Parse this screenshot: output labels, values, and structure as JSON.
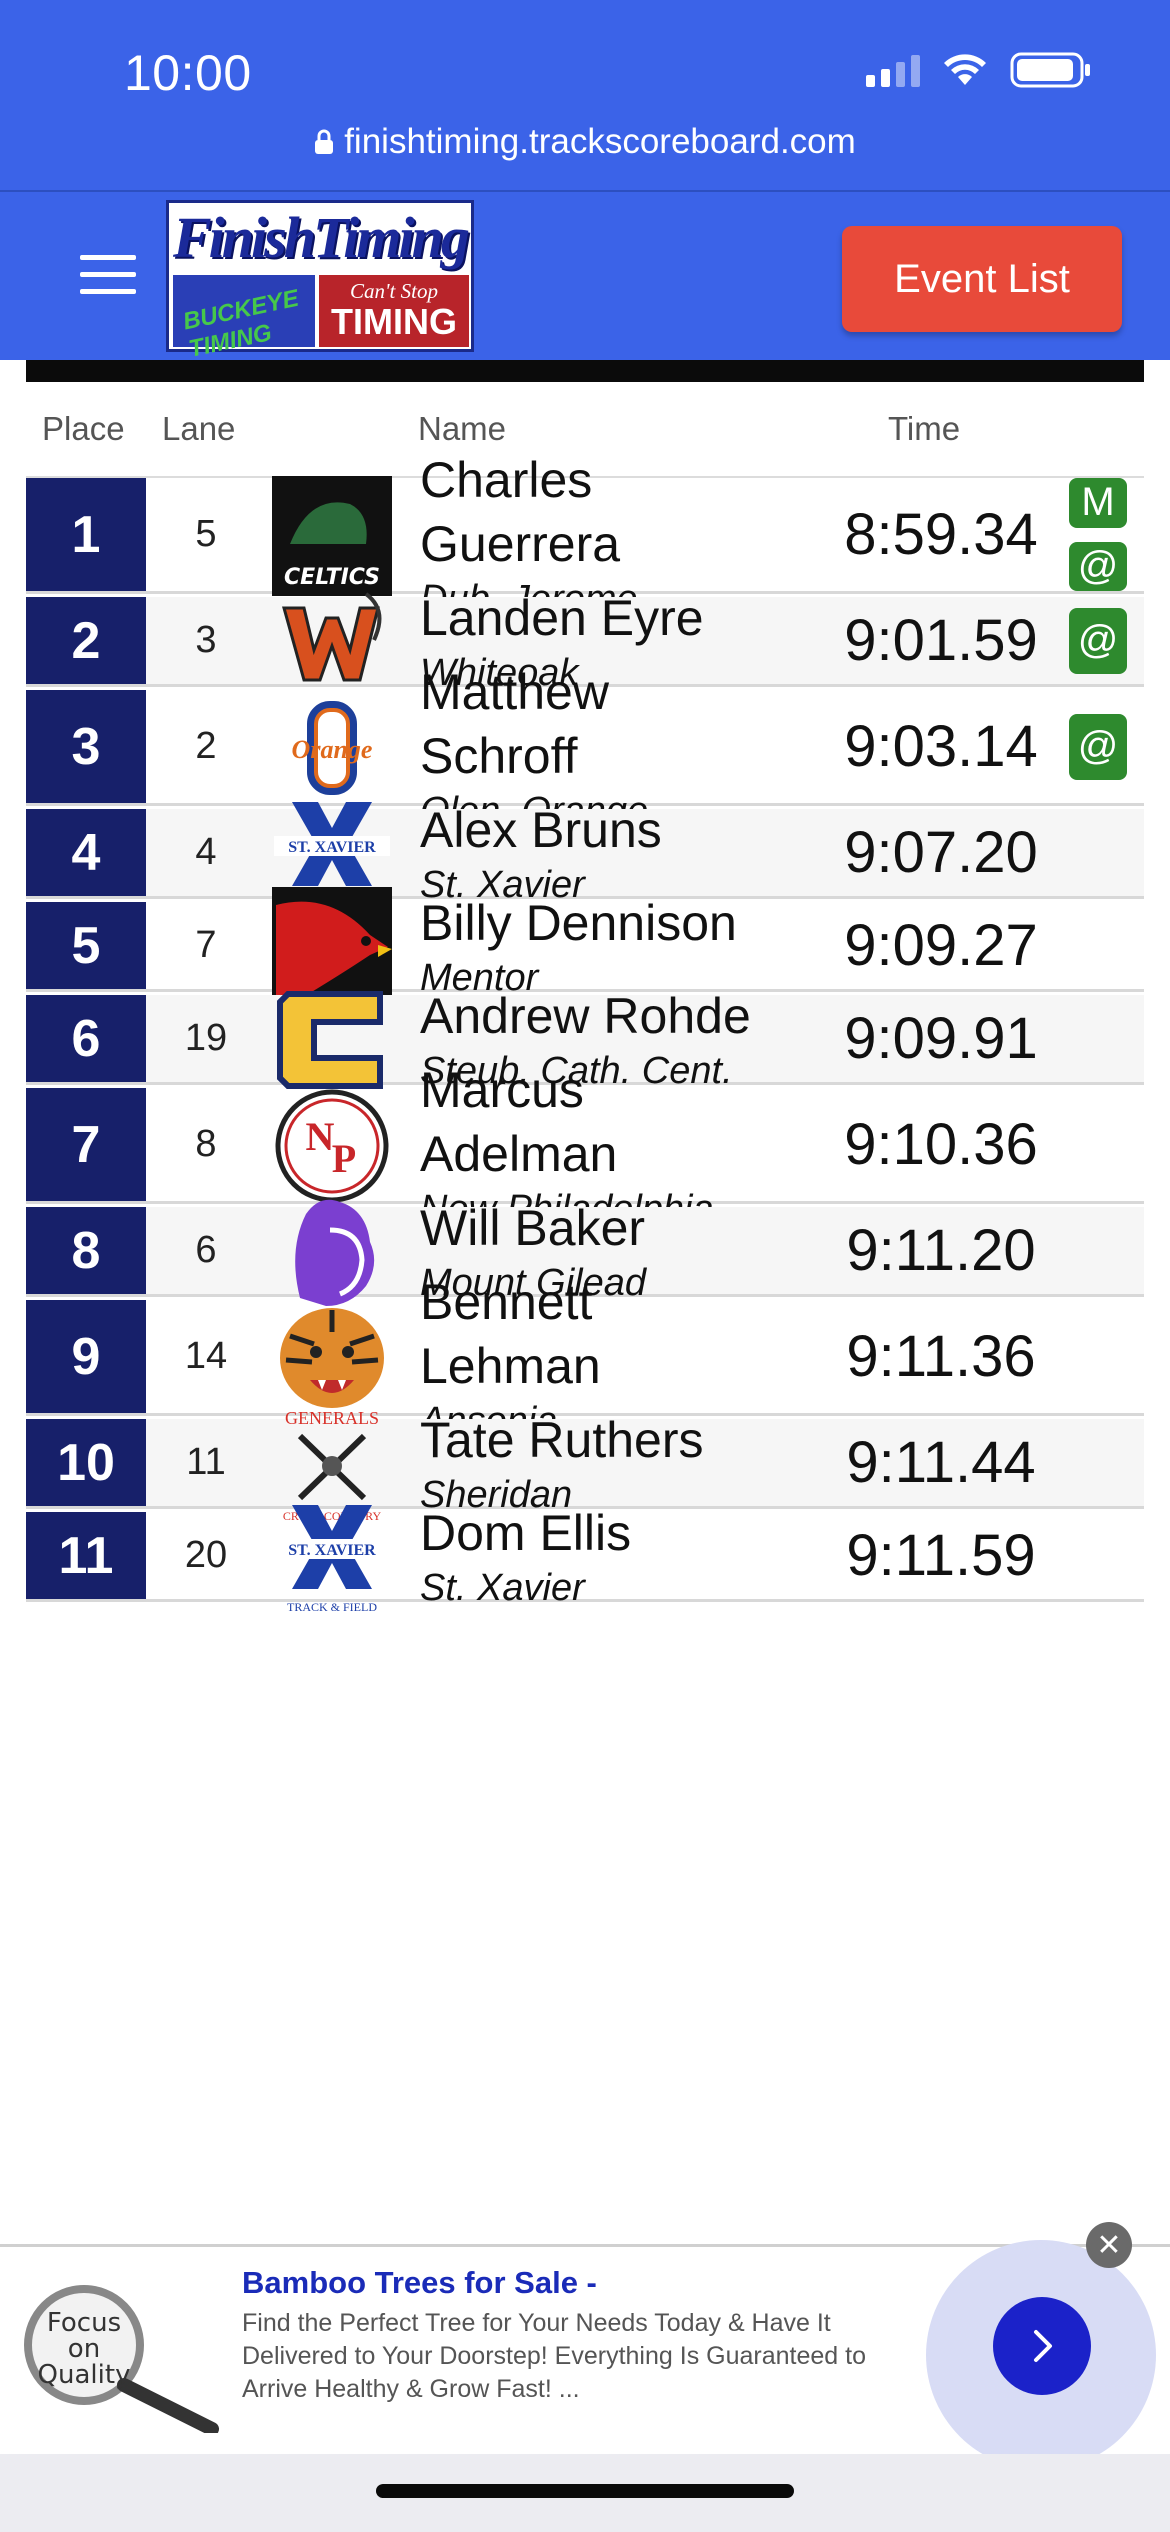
{
  "status": {
    "time": "10:00",
    "url": "finishtiming.trackscoreboard.com"
  },
  "header": {
    "logo": {
      "title": "FinishTiming",
      "left_text": "BUCKEYE TIMING",
      "right_sub": "Can't Stop",
      "right_main": "TIMING"
    },
    "event_list_label": "Event List"
  },
  "table": {
    "columns": {
      "place": "Place",
      "lane": "Lane",
      "name": "Name",
      "time": "Time"
    },
    "rows": [
      {
        "place": "1",
        "lane": "5",
        "name_lines": [
          "Charles",
          "Guerrera"
        ],
        "school": "Dub. Jerome",
        "time": "8:59.34",
        "badges": [
          "M",
          "@"
        ],
        "logo": "dublin-jerome-celtics-logo"
      },
      {
        "place": "2",
        "lane": "3",
        "name_lines": [
          "Landen Eyre"
        ],
        "school": "Whiteoak",
        "time": "9:01.59",
        "badges": [
          "@"
        ],
        "logo": "whiteoak-w-logo"
      },
      {
        "place": "3",
        "lane": "2",
        "name_lines": [
          "Matthew",
          "Schroff"
        ],
        "school": "Olen. Orange",
        "time": "9:03.14",
        "badges": [
          "@"
        ],
        "logo": "orange-o-logo"
      },
      {
        "place": "4",
        "lane": "4",
        "name_lines": [
          "Alex Bruns"
        ],
        "school": "St. Xavier",
        "time": "9:07.20",
        "badges": [],
        "logo": "st-xavier-logo"
      },
      {
        "place": "5",
        "lane": "7",
        "name_lines": [
          "Billy Dennison"
        ],
        "school": "Mentor",
        "time": "9:09.27",
        "badges": [],
        "logo": "cardinal-logo"
      },
      {
        "place": "6",
        "lane": "19",
        "name_lines": [
          "Andrew Rohde"
        ],
        "school": "Steub. Cath. Cent.",
        "time": "9:09.91",
        "badges": [],
        "logo": "catholic-central-c-logo"
      },
      {
        "place": "7",
        "lane": "8",
        "name_lines": [
          "Marcus",
          "Adelman"
        ],
        "school": "New Philadelphia",
        "time": "9:10.36",
        "badges": [],
        "logo": "new-philadelphia-np-logo"
      },
      {
        "place": "8",
        "lane": "6",
        "name_lines": [
          "Will Baker"
        ],
        "school": "Mount Gilead",
        "time": "9:11.20",
        "badges": [],
        "logo": "mount-gilead-logo"
      },
      {
        "place": "9",
        "lane": "14",
        "name_lines": [
          "Bennett",
          "Lehman"
        ],
        "school": "Ansonia",
        "time": "9:11.36",
        "badges": [],
        "logo": "tiger-logo"
      },
      {
        "place": "10",
        "lane": "11",
        "name_lines": [
          "Tate Ruthers"
        ],
        "school": "Sheridan",
        "time": "9:11.44",
        "badges": [],
        "logo": "sheridan-generals-logo"
      },
      {
        "place": "11",
        "lane": "20",
        "name_lines": [
          "Dom Ellis"
        ],
        "school": "St. Xavier",
        "time": "9:11.59",
        "badges": [],
        "logo": "st-xavier-logo"
      }
    ]
  },
  "ad": {
    "title": "Bamboo Trees for Sale -",
    "body": "Find the Perfect Tree for Your Needs Today & Have It Delivered to Your Doorstep! Everything Is Guaranteed to Arrive Healthy & Grow Fast! ...",
    "image_text": "Focus on Quality"
  },
  "colors": {
    "brand_blue": "#3b63e8",
    "place_navy": "#17206a",
    "event_btn": "#e84a3a",
    "badge_green": "#2e8a2e",
    "ad_title": "#1a2bb8"
  }
}
